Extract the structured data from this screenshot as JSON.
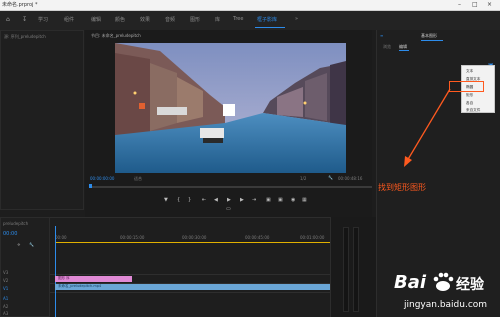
{
  "window": {
    "title": "未命名.prproj *"
  },
  "workspace": {
    "tabs": [
      "学习",
      "组件",
      "编辑",
      "颜色",
      "效果",
      "音频",
      "图形",
      "库",
      "Tree",
      "框子影库",
      "»"
    ],
    "active_index": 9
  },
  "source_panel": {
    "label": "源: 序列_preludepitch"
  },
  "program_panel": {
    "label": "节目: 未命名_preludepitch",
    "timecode_left": "00:00:00:00",
    "fit": "适合",
    "scale": "1/2",
    "timecode_right": "00:00:48:16"
  },
  "effects_panel": {
    "header": "基本图形",
    "tabs": [
      "浏览",
      "编辑"
    ]
  },
  "context_menu": {
    "items": [
      "文本",
      "直排文本",
      "椭圆",
      "矩形",
      "各自",
      "来自文件"
    ],
    "highlighted_index": 3
  },
  "annotation": {
    "text": "找到矩形图形"
  },
  "timeline": {
    "label": "preludepitch",
    "timecode": "00:00",
    "ruler": [
      "00:00",
      "00:00:15:00",
      "00:00:30:00",
      "00:00:45:00",
      "00:01:00:00"
    ],
    "tracks": [
      "V3",
      "V2",
      "V1",
      "A1",
      "A2",
      "A3"
    ],
    "clips": [
      {
        "label": "图形 序",
        "color": "#e08ad6"
      },
      {
        "label": "未命名_preludepitch.mp4",
        "color": "#6aa6d6"
      }
    ]
  },
  "watermark": {
    "brand": "Bai",
    "brand2": "百",
    "tail": "经验",
    "url": "jingyan.baidu.com"
  },
  "colors": {
    "accent": "#2d8ceb",
    "highlight": "#ff5a1f"
  }
}
